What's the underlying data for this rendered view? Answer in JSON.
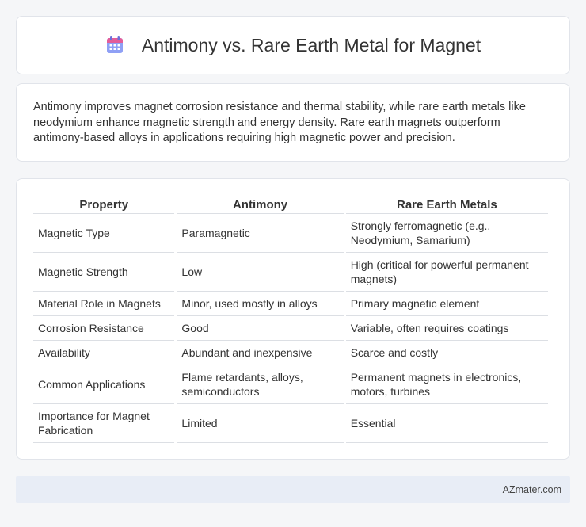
{
  "header": {
    "title": "Antimony vs. Rare Earth Metal for Magnet",
    "icon": "calendar-icon"
  },
  "summary": {
    "text": "Antimony improves magnet corrosion resistance and thermal stability, while rare earth metals like neodymium enhance magnetic strength and energy density. Rare earth magnets outperform antimony-based alloys in applications requiring high magnetic power and precision."
  },
  "table": {
    "headers": [
      "Property",
      "Antimony",
      "Rare Earth Metals"
    ],
    "rows": [
      [
        "Magnetic Type",
        "Paramagnetic",
        "Strongly ferromagnetic (e.g., Neodymium, Samarium)"
      ],
      [
        "Magnetic Strength",
        "Low",
        "High (critical for powerful permanent magnets)"
      ],
      [
        "Material Role in Magnets",
        "Minor, used mostly in alloys",
        "Primary magnetic element"
      ],
      [
        "Corrosion Resistance",
        "Good",
        "Variable, often requires coatings"
      ],
      [
        "Availability",
        "Abundant and inexpensive",
        "Scarce and costly"
      ],
      [
        "Common Applications",
        "Flame retardants, alloys, semiconductors",
        "Permanent magnets in electronics, motors, turbines"
      ],
      [
        "Importance for Magnet Fabrication",
        "Limited",
        "Essential"
      ]
    ]
  },
  "footer": {
    "text": "AZmater.com"
  },
  "colors": {
    "background": "#f5f6f8",
    "card": "#ffffff",
    "footer": "#e8edf6",
    "icon_top": "#e35d9a",
    "icon_body": "#7b8cf0"
  }
}
